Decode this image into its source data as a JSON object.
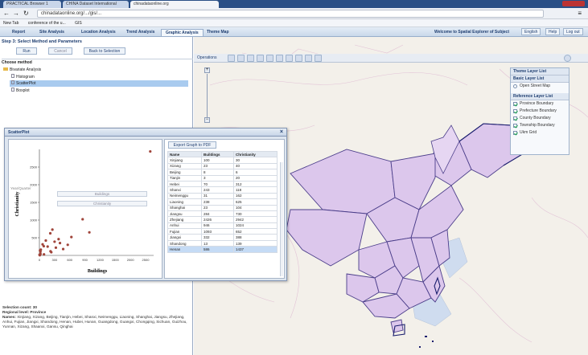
{
  "browser": {
    "tabs": [
      {
        "label": "PRACTICAL Browser 1"
      },
      {
        "label": "CHINA Dataset International"
      },
      {
        "label": "chinadataonline.org"
      }
    ],
    "url": "chinadataonline.org/.../gis/...",
    "bookmarks": [
      "New Tab",
      "conference of the u...",
      "GIS"
    ]
  },
  "appnav": {
    "tabs": [
      "Report",
      "Site Analysis",
      "Location Analysis",
      "Trend Analysis",
      "Graphic Analysis",
      "Theme Map"
    ],
    "welcome": "Welcome to Spatial Explorer of Subject",
    "lang_en": "English",
    "help": "Help",
    "logout": "Log out"
  },
  "left": {
    "step_title": "Step 3: Select Method and Parameters",
    "run": "Run",
    "cancel": "Cancel",
    "back": "Back to Selection",
    "choose_method": "Choose method",
    "tree": {
      "root": "Bivariate Analysis",
      "items": [
        "Histogram",
        "ScatterPlot",
        "Boxplot"
      ]
    },
    "axis_x_label": "Year/Quarter",
    "axis_field_1": "Buildings",
    "axis_field_2": "Christianity",
    "selection_count": "Selection count: 30",
    "regional_level": "Regional level: Province",
    "names_label": "Names:",
    "names": "Xinjiang, Xizang, Beijing, Tianjin, Hebei, Shanxi, Neimenggu, Liaoning, Shanghai, Jiangsu, Zhejiang, Anhui, Fujian, Jiangxi, Shandong, Henan, Hubei, Hunan, Guangdong, Guangxi, Chongqing, Sichuan, Guizhou, Yunnan, Xizang, Shaanxi, Gansu, Qinghai"
  },
  "map": {
    "toolbar_label": "Operations",
    "layers": {
      "theme_header": "Theme Layer List",
      "basic_header": "Basic Layer List",
      "basic_items": [
        "Open Street Map"
      ],
      "ref_header": "Reference Layer List",
      "ref_items": [
        "Province Boundary",
        "Prefecture Boundary",
        "County Boundary",
        "Township Boundary",
        "Ukm Grid"
      ]
    }
  },
  "scatter": {
    "title": "ScatterPlot",
    "export": "Export Graph to PDF",
    "col_name": "Name",
    "col_x": "Buildings",
    "col_y": "Christianity",
    "rows": [
      [
        "Xinjiang",
        "100",
        "30"
      ],
      [
        "Xizang",
        "23",
        "40"
      ],
      [
        "Beijing",
        "8",
        "6"
      ],
      [
        "Tianjin",
        "3",
        "20"
      ],
      [
        "Hebei",
        "70",
        "312"
      ],
      [
        "Shanxi",
        "243",
        "118"
      ],
      [
        "Neimenggu",
        "31",
        "162"
      ],
      [
        "Liaoning",
        "238",
        "625"
      ],
      [
        "Shanghai",
        "23",
        "104"
      ],
      [
        "Jiangsu",
        "284",
        "730"
      ],
      [
        "Zhejiang",
        "2426",
        "2942"
      ],
      [
        "Anhui",
        "946",
        "1024"
      ],
      [
        "Fujian",
        "1093",
        "652"
      ],
      [
        "Jiangxi",
        "332",
        "388"
      ],
      [
        "Shandong",
        "13",
        "139"
      ],
      [
        "Henan",
        "586",
        "1437"
      ]
    ]
  },
  "chart_data": {
    "type": "scatter",
    "xlabel": "Buildings",
    "ylabel": "Christianity",
    "xlim": [
      0,
      2500
    ],
    "ylim": [
      0,
      3000
    ],
    "x_ticks": [
      "0",
      "300",
      "600",
      "900",
      "1200",
      "1500",
      "2000",
      "2500"
    ],
    "y_ticks": [
      "500",
      "1000",
      "1500",
      "2000",
      "2500"
    ],
    "points": [
      [
        2426,
        2942
      ],
      [
        946,
        1024
      ],
      [
        1093,
        652
      ],
      [
        586,
        1437
      ],
      [
        100,
        30
      ],
      [
        23,
        40
      ],
      [
        8,
        6
      ],
      [
        3,
        20
      ],
      [
        70,
        312
      ],
      [
        243,
        118
      ],
      [
        31,
        162
      ],
      [
        238,
        625
      ],
      [
        23,
        104
      ],
      [
        284,
        730
      ],
      [
        332,
        388
      ],
      [
        13,
        139
      ],
      [
        620,
        300
      ],
      [
        420,
        460
      ],
      [
        180,
        250
      ],
      [
        520,
        180
      ],
      [
        360,
        220
      ],
      [
        140,
        420
      ],
      [
        700,
        520
      ],
      [
        260,
        90
      ],
      [
        450,
        350
      ],
      [
        95,
        260
      ]
    ],
    "color": "#a0443a"
  },
  "colors": {
    "china_fill": "#dcc7ec",
    "china_stroke": "#4b3e8a",
    "accent": "#1f3e70"
  }
}
